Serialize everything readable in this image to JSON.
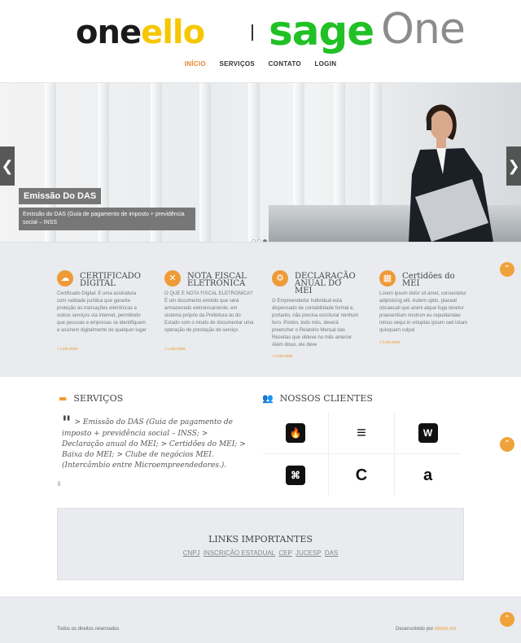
{
  "header": {
    "logo": {
      "one_a": "one",
      "one_b": "ello",
      "sage": "sage",
      "sage_one": "One"
    },
    "nav": [
      "INÍCIO",
      "SERVIÇOS",
      "CONTATO",
      "LOGIN"
    ]
  },
  "slider": {
    "prev": "❮",
    "next": "❯",
    "caption_title": "Emissão Do DAS",
    "caption_text": "Emissão do DAS (Guia de pagamento de imposto + previdência social – INSS",
    "dots": 3,
    "active_dot": 3
  },
  "services": [
    {
      "icon": "cloud-icon",
      "glyph": "☁",
      "title": "CERTIFICADO DIGITAL",
      "desc": "Certificado Digital: É uma assinatura com validade jurídica que garante proteção às transações eletrônicas e outros serviços via internet, permitindo que pessoas e empresas se identifiquem e assinem digitalmente de qualquer lugar",
      "more": "» Leia mais"
    },
    {
      "icon": "tools-icon",
      "glyph": "✕",
      "title": "NOTA FISCAL ELETRÔNICA",
      "desc": "O QUE É NOTA FISCAL ELETRÔNICA? É um documento emitido que será armazenado eletronicamente, em sistema próprio da Prefeitura ou do Estado com o intuito de documentar uma operação de prestação de serviço",
      "more": "» Leia mais"
    },
    {
      "icon": "gear-icon",
      "glyph": "⚙",
      "title": "DECLARAÇÃO ANUAL DO MEI",
      "desc": "O Empreendedor Individual está dispensado de contabilidade formal e, portanto, não precisa escriturar nenhum livro. Porém, todo mês, deverá preencher o Relatório Mensal das Receitas que obteve no mês anterior. Além disso, ele deve",
      "more": "» Leia mais"
    },
    {
      "icon": "grid-icon",
      "glyph": "▦",
      "title": "Certidões do MEI",
      "desc": "Lorem ipsum dolor sit amet, consectetur adipisicing elit. Autem optio, placeat obcaecati quo animi atque fuga tenetur praesentium nostrum eu repudiandae minus sequi in voluptas ipsum sed totam quisquam culpa!",
      "more": "» Leia mais"
    }
  ],
  "main": {
    "services_title": "SERVIÇOS",
    "quote": "> Emissão do DAS (Guia de pagamento de imposto + previdência social – INSS; > Declaração anual do MEI; > Certidões do MEI; > Baixa do MEI; > Clube de negócios MEI. (Intercâmbio entre Microempreendedores.).",
    "quote_mark": "\"",
    "small_link": "ll",
    "clients_title": "NOSSOS CLIENTES",
    "clients": [
      {
        "name": "firebase-icon",
        "glyph": "🔥"
      },
      {
        "name": "stackoverflow-icon",
        "glyph": "≡"
      },
      {
        "name": "wikipedia-icon",
        "glyph": "W"
      },
      {
        "name": "github-icon",
        "glyph": "⌘"
      },
      {
        "name": "codepen-icon",
        "glyph": "C"
      },
      {
        "name": "amazon-icon",
        "glyph": "a"
      }
    ]
  },
  "links": {
    "title": "LINKS IMPORTANTES",
    "items": [
      "CNPJ",
      "INSCRIÇÃO ESTADUAL",
      "CEP",
      "JUCESP",
      "DAS"
    ]
  },
  "footer": {
    "left": "Todos os direitos reservados",
    "right_prefix": "Desenvolvido por ",
    "right_link": "Alvitre.net"
  },
  "colors": {
    "accent": "#ee9b37",
    "sage_green": "#21c126",
    "logo_yellow": "#f6c700"
  }
}
